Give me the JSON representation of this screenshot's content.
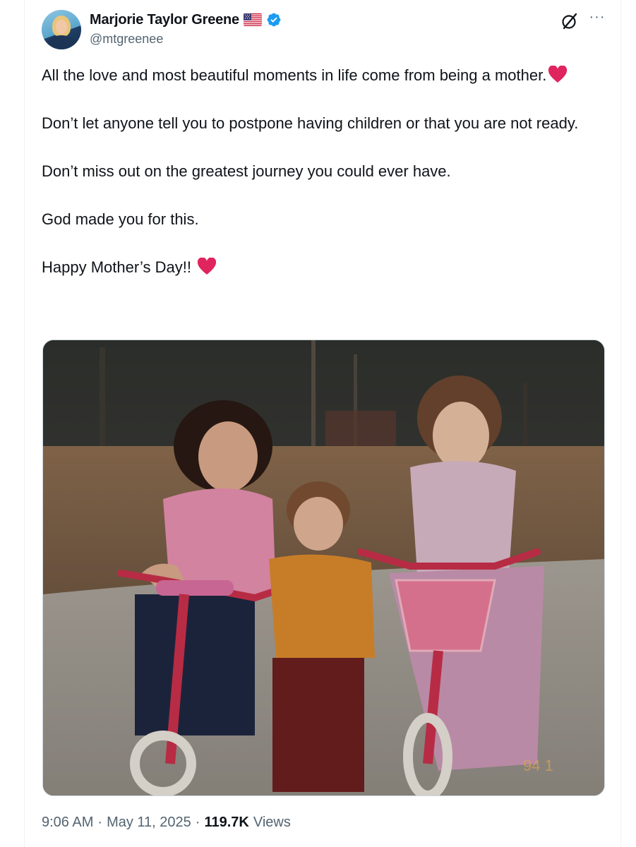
{
  "author": {
    "display_name": "Marjorie Taylor Greene",
    "handle": "@mtgreenee",
    "flag_icon": "us-flag-icon",
    "verified_icon": "verified-badge-icon",
    "verified_color": "#1d9bf0"
  },
  "actions": {
    "grok_icon": "grok-icon",
    "more_icon": "more-options-icon",
    "more_label": "···"
  },
  "tweet": {
    "paragraphs": [
      "All the love and most beautiful moments in life come from being a mother.",
      "Don’t let anyone tell you to postpone having children or that you are not ready.",
      "Don’t miss out on the greatest journey you could ever have.",
      "God made you for this.",
      "Happy Mother’s Day!!"
    ],
    "emoji": "red-heart-icon"
  },
  "media": {
    "photo_stamp": "94  1"
  },
  "footer": {
    "time": "9:06 AM",
    "separator1": "·",
    "date": "May 11, 2025",
    "separator2": "·",
    "views_count": "119.7K",
    "views_label": "Views"
  },
  "colors": {
    "text_primary": "#0f1419",
    "text_secondary": "#536471",
    "heart": "#e0245e"
  }
}
